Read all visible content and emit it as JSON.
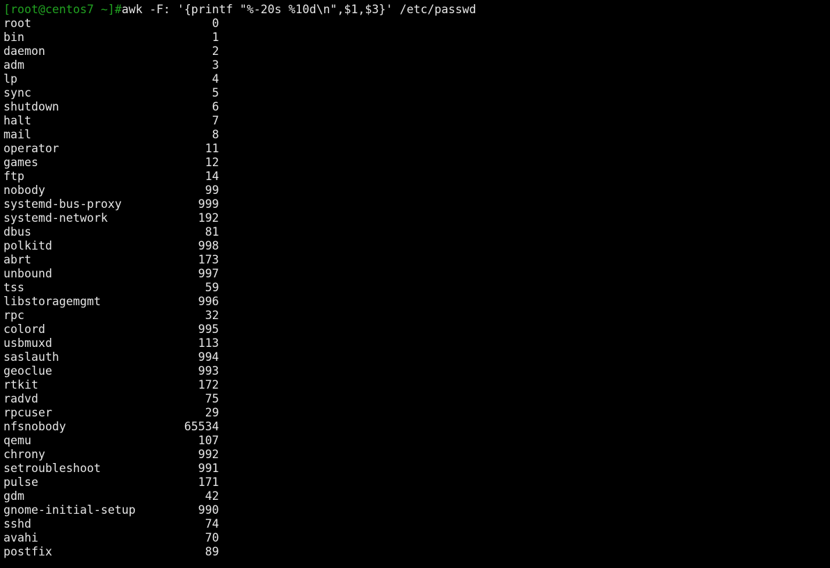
{
  "terminal": {
    "prompt": "[root@centos7 ~]#",
    "command": "awk -F: '{printf \"%-20s %10d\\n\",$1,$3}' /etc/passwd",
    "prompt_color": "#21a121",
    "rows": [
      {
        "name": "root",
        "uid": "0"
      },
      {
        "name": "bin",
        "uid": "1"
      },
      {
        "name": "daemon",
        "uid": "2"
      },
      {
        "name": "adm",
        "uid": "3"
      },
      {
        "name": "lp",
        "uid": "4"
      },
      {
        "name": "sync",
        "uid": "5"
      },
      {
        "name": "shutdown",
        "uid": "6"
      },
      {
        "name": "halt",
        "uid": "7"
      },
      {
        "name": "mail",
        "uid": "8"
      },
      {
        "name": "operator",
        "uid": "11"
      },
      {
        "name": "games",
        "uid": "12"
      },
      {
        "name": "ftp",
        "uid": "14"
      },
      {
        "name": "nobody",
        "uid": "99"
      },
      {
        "name": "systemd-bus-proxy",
        "uid": "999"
      },
      {
        "name": "systemd-network",
        "uid": "192"
      },
      {
        "name": "dbus",
        "uid": "81"
      },
      {
        "name": "polkitd",
        "uid": "998"
      },
      {
        "name": "abrt",
        "uid": "173"
      },
      {
        "name": "unbound",
        "uid": "997"
      },
      {
        "name": "tss",
        "uid": "59"
      },
      {
        "name": "libstoragemgmt",
        "uid": "996"
      },
      {
        "name": "rpc",
        "uid": "32"
      },
      {
        "name": "colord",
        "uid": "995"
      },
      {
        "name": "usbmuxd",
        "uid": "113"
      },
      {
        "name": "saslauth",
        "uid": "994"
      },
      {
        "name": "geoclue",
        "uid": "993"
      },
      {
        "name": "rtkit",
        "uid": "172"
      },
      {
        "name": "radvd",
        "uid": "75"
      },
      {
        "name": "rpcuser",
        "uid": "29"
      },
      {
        "name": "nfsnobody",
        "uid": "65534"
      },
      {
        "name": "qemu",
        "uid": "107"
      },
      {
        "name": "chrony",
        "uid": "992"
      },
      {
        "name": "setroubleshoot",
        "uid": "991"
      },
      {
        "name": "pulse",
        "uid": "171"
      },
      {
        "name": "gdm",
        "uid": "42"
      },
      {
        "name": "gnome-initial-setup",
        "uid": "990"
      },
      {
        "name": "sshd",
        "uid": "74"
      },
      {
        "name": "avahi",
        "uid": "70"
      },
      {
        "name": "postfix",
        "uid": "89"
      }
    ]
  }
}
